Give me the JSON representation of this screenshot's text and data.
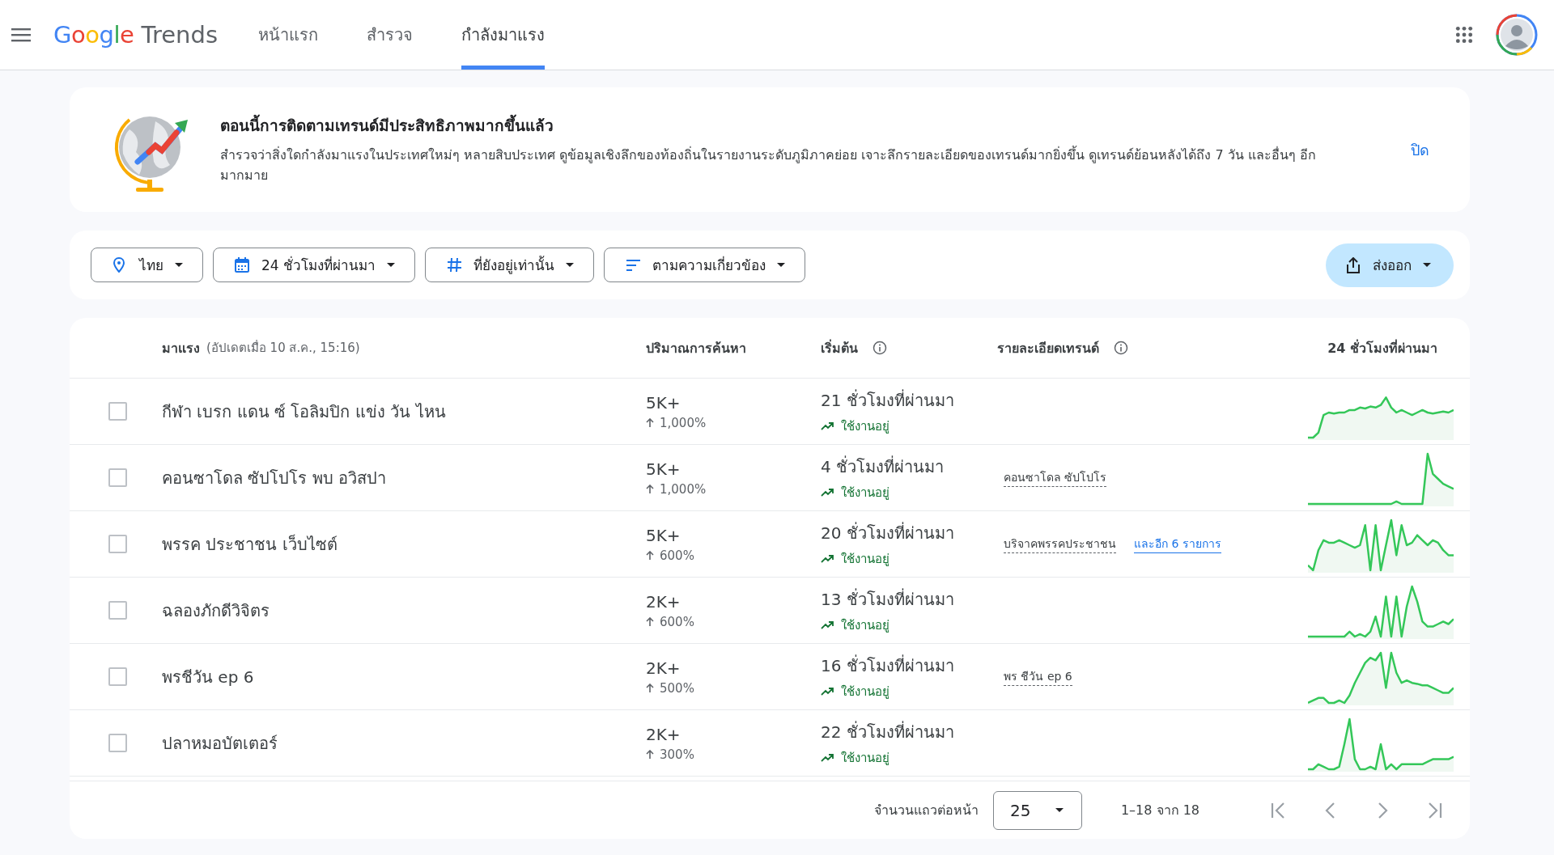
{
  "header": {
    "logo": {
      "brand": "Google",
      "product": "Trends"
    },
    "tabs": [
      {
        "label": "หน้าแรก",
        "selected": false
      },
      {
        "label": "สำรวจ",
        "selected": false
      },
      {
        "label": "กำลังมาแรง",
        "selected": true
      }
    ]
  },
  "banner": {
    "title": "ตอนนี้การติดตามเทรนด์มีประสิทธิภาพมากขึ้นแล้ว",
    "body": "สำรวจว่าสิ่งใดกำลังมาแรงในประเทศใหม่ๆ หลายสิบประเทศ ดูข้อมูลเชิงลึกของท้องถิ่นในรายงานระดับภูมิภาคย่อย เจาะลึกรายละเอียดของเทรนด์มากยิ่งขึ้น ดูเทรนด์ย้อนหลังได้ถึง 7 วัน และอื่นๆ อีกมากมาย",
    "close": "ปิด"
  },
  "filters": [
    {
      "kind": "location",
      "label": "ไทย"
    },
    {
      "kind": "calendar",
      "label": "24 ชั่วโมงที่ผ่านมา"
    },
    {
      "kind": "hash",
      "label": "ที่ยังอยู่เท่านั้น"
    },
    {
      "kind": "sort",
      "label": "ตามความเกี่ยวข้อง"
    }
  ],
  "export": {
    "label": "ส่งออก"
  },
  "table": {
    "columns": [
      {
        "label": "มาแรง",
        "note": "(อัปเดตเมื่อ 10 ส.ค., 15:16)",
        "info": false
      },
      {
        "label": "ปริมาณการค้นหา",
        "info": false
      },
      {
        "label": "เริ่มต้น",
        "info": true
      },
      {
        "label": "รายละเอียดเทรนด์",
        "info": true
      },
      {
        "label": "24 ชั่วโมงที่ผ่านมา",
        "info": false
      }
    ],
    "rows": [
      {
        "checked": false,
        "term": "กีฬา เบรก แดน ซ์ โอลิมปิก แข่ง วัน ไหน",
        "volume": "5K+",
        "change": "1,000%",
        "started": "21 ชั่วโมงที่ผ่านมา",
        "status": "ใช้งานอยู่",
        "details": []
      },
      {
        "checked": false,
        "term": "คอนซาโดล ซัปโปโร พบ อวิสปา",
        "volume": "5K+",
        "change": "1,000%",
        "started": "4 ชั่วโมงที่ผ่านมา",
        "status": "ใช้งานอยู่",
        "details": [
          {
            "kind": "term",
            "text": "คอนซาโดล ซัปโปโร"
          }
        ]
      },
      {
        "checked": false,
        "term": "พรรค ประชาชน เว็บไซต์",
        "volume": "5K+",
        "change": "600%",
        "started": "20 ชั่วโมงที่ผ่านมา",
        "status": "ใช้งานอยู่",
        "details": [
          {
            "kind": "term",
            "text": "บริจาคพรรคประชาชน"
          },
          {
            "kind": "more",
            "text": "และอีก 6 รายการ"
          }
        ]
      },
      {
        "checked": false,
        "term": "ฉลองภักดีวิจิตร",
        "volume": "2K+",
        "change": "600%",
        "started": "13 ชั่วโมงที่ผ่านมา",
        "status": "ใช้งานอยู่",
        "details": []
      },
      {
        "checked": false,
        "term": "พรชีวัน ep 6",
        "volume": "2K+",
        "change": "500%",
        "started": "16 ชั่วโมงที่ผ่านมา",
        "status": "ใช้งานอยู่",
        "details": [
          {
            "kind": "term",
            "text": "พร ชีวัน ep 6"
          }
        ]
      },
      {
        "checked": false,
        "term": "ปลาหมอบัตเตอร์",
        "volume": "2K+",
        "change": "300%",
        "started": "22 ชั่วโมงที่ผ่านมา",
        "status": "ใช้งานอยู่",
        "details": []
      }
    ]
  },
  "pagination": {
    "rows_label": "จำนวนแถวต่อหน้า",
    "rows_per_page": "25",
    "range": "1–18 จาก 18"
  }
}
